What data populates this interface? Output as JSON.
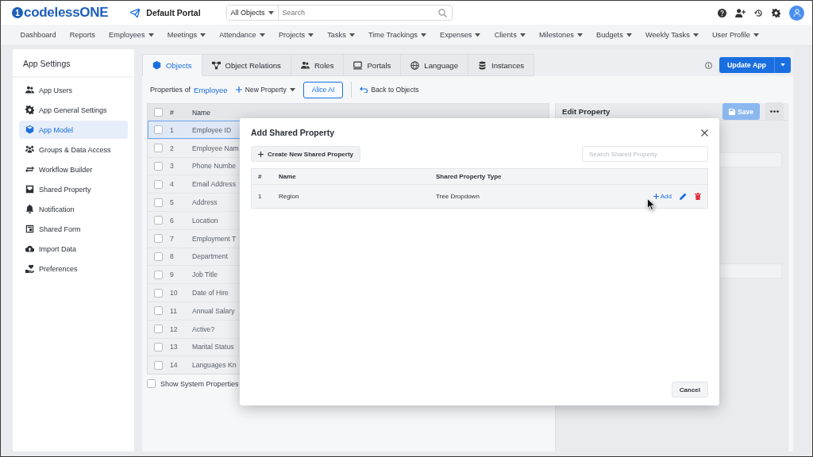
{
  "header": {
    "logo_mark": "1",
    "logo": "codelessONE",
    "portal": "Default Portal",
    "scope": "All Objects",
    "search_placeholder": "Search"
  },
  "nav": [
    {
      "label": "Dashboard",
      "dropdown": false
    },
    {
      "label": "Reports",
      "dropdown": false
    },
    {
      "label": "Employees",
      "dropdown": true
    },
    {
      "label": "Meetings",
      "dropdown": true
    },
    {
      "label": "Attendance",
      "dropdown": true
    },
    {
      "label": "Projects",
      "dropdown": true
    },
    {
      "label": "Tasks",
      "dropdown": true
    },
    {
      "label": "Time Trackings",
      "dropdown": true
    },
    {
      "label": "Expenses",
      "dropdown": true
    },
    {
      "label": "Clients",
      "dropdown": true
    },
    {
      "label": "Milestones",
      "dropdown": true
    },
    {
      "label": "Budgets",
      "dropdown": true
    },
    {
      "label": "Weekly Tasks",
      "dropdown": true
    },
    {
      "label": "User Profile",
      "dropdown": true
    }
  ],
  "sidebar": {
    "title": "App Settings",
    "items": [
      {
        "label": "App Users",
        "selected": false
      },
      {
        "label": "App General Settings",
        "selected": false
      },
      {
        "label": "App Model",
        "selected": true
      },
      {
        "label": "Groups & Data Access",
        "selected": false
      },
      {
        "label": "Workflow Builder",
        "selected": false
      },
      {
        "label": "Shared Property",
        "selected": false
      },
      {
        "label": "Notification",
        "selected": false
      },
      {
        "label": "Shared Form",
        "selected": false
      },
      {
        "label": "Import Data",
        "selected": false
      },
      {
        "label": "Preferences",
        "selected": false
      }
    ]
  },
  "tabs": [
    {
      "label": "Objects",
      "selected": true
    },
    {
      "label": "Object Relations",
      "selected": false
    },
    {
      "label": "Roles",
      "selected": false
    },
    {
      "label": "Portals",
      "selected": false
    },
    {
      "label": "Language",
      "selected": false
    },
    {
      "label": "Instances",
      "selected": false
    }
  ],
  "update_button": "Update App",
  "toolbar": {
    "prefix": "Properties of",
    "object": "Employee",
    "new_property": "New Property",
    "ai": "Alice AI",
    "back": "Back to Objects"
  },
  "table": {
    "all_checked": false,
    "columns": [
      "#",
      "Name"
    ],
    "rows": [
      {
        "number": "1",
        "name": "Employee ID",
        "selected": true,
        "checked": false
      },
      {
        "number": "2",
        "name": "Employee Nam",
        "selected": false,
        "checked": false
      },
      {
        "number": "3",
        "name": "Phone Numbe",
        "selected": false,
        "checked": false
      },
      {
        "number": "4",
        "name": "Email Address",
        "selected": false,
        "checked": false
      },
      {
        "number": "5",
        "name": "Address",
        "selected": false,
        "checked": false
      },
      {
        "number": "6",
        "name": "Location",
        "selected": false,
        "checked": false
      },
      {
        "number": "7",
        "name": "Employment T",
        "selected": false,
        "checked": false
      },
      {
        "number": "8",
        "name": "Department",
        "selected": false,
        "checked": false
      },
      {
        "number": "9",
        "name": "Job Title",
        "selected": false,
        "checked": false
      },
      {
        "number": "10",
        "name": "Date of Hire",
        "selected": false,
        "checked": false
      },
      {
        "number": "11",
        "name": "Annual Salary",
        "selected": false,
        "checked": false
      },
      {
        "number": "12",
        "name": "Active?",
        "selected": false,
        "checked": false
      },
      {
        "number": "13",
        "name": "Marital Status",
        "selected": false,
        "checked": false
      },
      {
        "number": "14",
        "name": "Languages Kn",
        "selected": false,
        "checked": false
      }
    ]
  },
  "show_system": {
    "label": "Show System Properties",
    "checked": false
  },
  "edit_panel": {
    "title": "Edit Property",
    "save": "Save",
    "save_disabled": true
  },
  "modal": {
    "title": "Add Shared Property",
    "create": "Create New Shared Property",
    "search_placeholder": "Search Shared Property",
    "columns": [
      "#",
      "Name",
      "Shared Property Type"
    ],
    "rows": [
      {
        "number": "1",
        "name": "Region",
        "type": "Tree Dropdown",
        "action": "Add"
      }
    ],
    "cancel": "Cancel"
  }
}
